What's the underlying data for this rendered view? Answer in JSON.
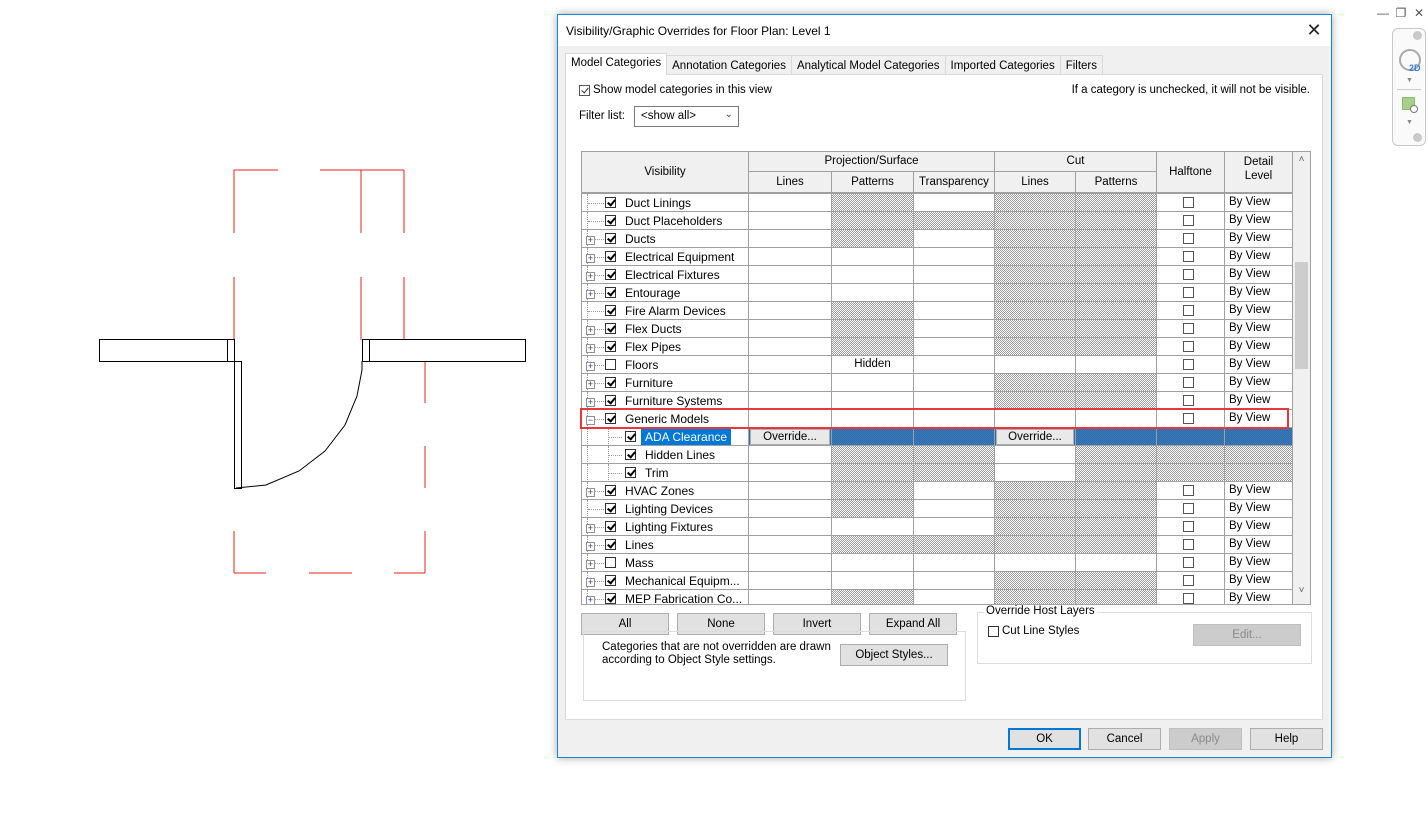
{
  "window_controls": {
    "minimize": "—",
    "restore": "❐",
    "close": "✕"
  },
  "nav_bar": {
    "wheel_label": "2D"
  },
  "drawing": {
    "door_swing": "door swing arc",
    "clearance_color": "#e8201e",
    "line_color": "#000000"
  },
  "dialog": {
    "title": "Visibility/Graphic Overrides for Floor Plan: Level 1",
    "close_glyph": "✕",
    "tabs": [
      {
        "label": "Model Categories",
        "active": true
      },
      {
        "label": "Annotation Categories",
        "active": false
      },
      {
        "label": "Analytical Model Categories",
        "active": false
      },
      {
        "label": "Imported Categories",
        "active": false
      },
      {
        "label": "Filters",
        "active": false
      }
    ],
    "show_model_categories": {
      "label": "Show model categories in this view",
      "checked": true
    },
    "hint": "If a category is unchecked, it will not be visible.",
    "filter_list": {
      "label": "Filter list:",
      "value": "<show all>"
    },
    "grid": {
      "headers": {
        "visibility": "Visibility",
        "projection_surface": "Projection/Surface",
        "proj_lines": "Lines",
        "proj_patterns": "Patterns",
        "transparency": "Transparency",
        "cut": "Cut",
        "cut_lines": "Lines",
        "cut_patterns": "Patterns",
        "halftone": "Halftone",
        "detail_level": "Detail Level"
      },
      "rows": [
        {
          "name": "Duct Linings",
          "level": 0,
          "expander": "",
          "checked": true,
          "proj_lines": "",
          "proj_patterns": "",
          "transparency": "",
          "cut_lines": "",
          "cut_patterns": "",
          "halftone": false,
          "detail": "By View",
          "shade": [
            0,
            1,
            0,
            1,
            1
          ]
        },
        {
          "name": "Duct Placeholders",
          "level": 0,
          "expander": "",
          "checked": true,
          "proj_patterns": "",
          "halftone": false,
          "detail": "By View",
          "shade": [
            0,
            1,
            1,
            1,
            1
          ]
        },
        {
          "name": "Ducts",
          "level": 0,
          "expander": "+",
          "checked": true,
          "halftone": false,
          "detail": "By View",
          "shade": [
            0,
            1,
            0,
            1,
            1
          ]
        },
        {
          "name": "Electrical Equipment",
          "level": 0,
          "expander": "+",
          "checked": true,
          "halftone": false,
          "detail": "By View",
          "shade": [
            0,
            0,
            0,
            1,
            1
          ]
        },
        {
          "name": "Electrical Fixtures",
          "level": 0,
          "expander": "+",
          "checked": true,
          "halftone": false,
          "detail": "By View",
          "shade": [
            0,
            0,
            0,
            1,
            1
          ]
        },
        {
          "name": "Entourage",
          "level": 0,
          "expander": "+",
          "checked": true,
          "halftone": false,
          "detail": "By View",
          "shade": [
            0,
            0,
            0,
            1,
            1
          ]
        },
        {
          "name": "Fire Alarm Devices",
          "level": 0,
          "expander": "",
          "checked": true,
          "halftone": false,
          "detail": "By View",
          "shade": [
            0,
            1,
            0,
            1,
            1
          ]
        },
        {
          "name": "Flex Ducts",
          "level": 0,
          "expander": "+",
          "checked": true,
          "halftone": false,
          "detail": "By View",
          "shade": [
            0,
            1,
            0,
            1,
            1
          ]
        },
        {
          "name": "Flex Pipes",
          "level": 0,
          "expander": "+",
          "checked": true,
          "halftone": false,
          "detail": "By View",
          "shade": [
            0,
            1,
            0,
            1,
            1
          ]
        },
        {
          "name": "Floors",
          "level": 0,
          "expander": "+",
          "checked": false,
          "proj_patterns": "Hidden",
          "halftone": false,
          "detail": "By View",
          "shade": [
            0,
            0,
            0,
            0,
            0
          ]
        },
        {
          "name": "Furniture",
          "level": 0,
          "expander": "+",
          "checked": true,
          "halftone": false,
          "detail": "By View",
          "shade": [
            0,
            0,
            0,
            1,
            1
          ]
        },
        {
          "name": "Furniture Systems",
          "level": 0,
          "expander": "+",
          "checked": true,
          "halftone": false,
          "detail": "By View",
          "shade": [
            0,
            0,
            0,
            1,
            1
          ]
        },
        {
          "name": "Generic Models",
          "level": 0,
          "expander": "−",
          "checked": true,
          "halftone": false,
          "detail": "By View",
          "shade": [
            0,
            0,
            0,
            0,
            0
          ]
        },
        {
          "name": "ADA Clearance",
          "level": 1,
          "expander": "",
          "checked": true,
          "selected": true,
          "proj_override": "Override...",
          "cut_override": "Override...",
          "shade": [
            0,
            1,
            1,
            0,
            1,
            1,
            1
          ]
        },
        {
          "name": "Hidden Lines",
          "level": 1,
          "expander": "",
          "checked": true,
          "subcategory": true,
          "shade": [
            0,
            1,
            1,
            0,
            1,
            1,
            1
          ]
        },
        {
          "name": "Trim",
          "level": 1,
          "expander": "",
          "checked": true,
          "subcategory": true,
          "shade": [
            0,
            1,
            1,
            0,
            1,
            1,
            1
          ]
        },
        {
          "name": "HVAC Zones",
          "level": 0,
          "expander": "+",
          "checked": true,
          "halftone": false,
          "detail": "By View",
          "shade": [
            0,
            1,
            0,
            1,
            1
          ]
        },
        {
          "name": "Lighting Devices",
          "level": 0,
          "expander": "",
          "checked": true,
          "halftone": false,
          "detail": "By View",
          "shade": [
            0,
            1,
            0,
            1,
            1
          ]
        },
        {
          "name": "Lighting Fixtures",
          "level": 0,
          "expander": "+",
          "checked": true,
          "halftone": false,
          "detail": "By View",
          "shade": [
            0,
            0,
            0,
            1,
            1
          ]
        },
        {
          "name": "Lines",
          "level": 0,
          "expander": "+",
          "checked": true,
          "halftone": false,
          "detail": "By View",
          "shade": [
            0,
            1,
            1,
            1,
            1
          ]
        },
        {
          "name": "Mass",
          "level": 0,
          "expander": "+",
          "checked": false,
          "halftone": false,
          "detail": "By View",
          "shade": [
            0,
            0,
            0,
            0,
            0
          ]
        },
        {
          "name": "Mechanical Equipm...",
          "level": 0,
          "expander": "+",
          "checked": true,
          "halftone": false,
          "detail": "By View",
          "shade": [
            0,
            0,
            0,
            1,
            1
          ]
        },
        {
          "name": "MEP Fabrication Co...",
          "level": 0,
          "expander": "+",
          "checked": true,
          "halftone": false,
          "detail": "By View",
          "shade": [
            0,
            1,
            0,
            1,
            1
          ]
        }
      ],
      "scroll_up": "˄",
      "scroll_down": "˅"
    },
    "buttons": {
      "all": "All",
      "none": "None",
      "invert": "Invert",
      "expand_all": "Expand All",
      "object_styles": "Object Styles...",
      "edit": "Edit...",
      "ok": "OK",
      "cancel": "Cancel",
      "apply": "Apply",
      "help": "Help"
    },
    "note": "Categories that are not overridden are drawn according to Object Style settings.",
    "override_host_layers": {
      "legend": "Override Host Layers",
      "cut_line_styles": {
        "label": "Cut Line Styles",
        "checked": false
      }
    }
  }
}
